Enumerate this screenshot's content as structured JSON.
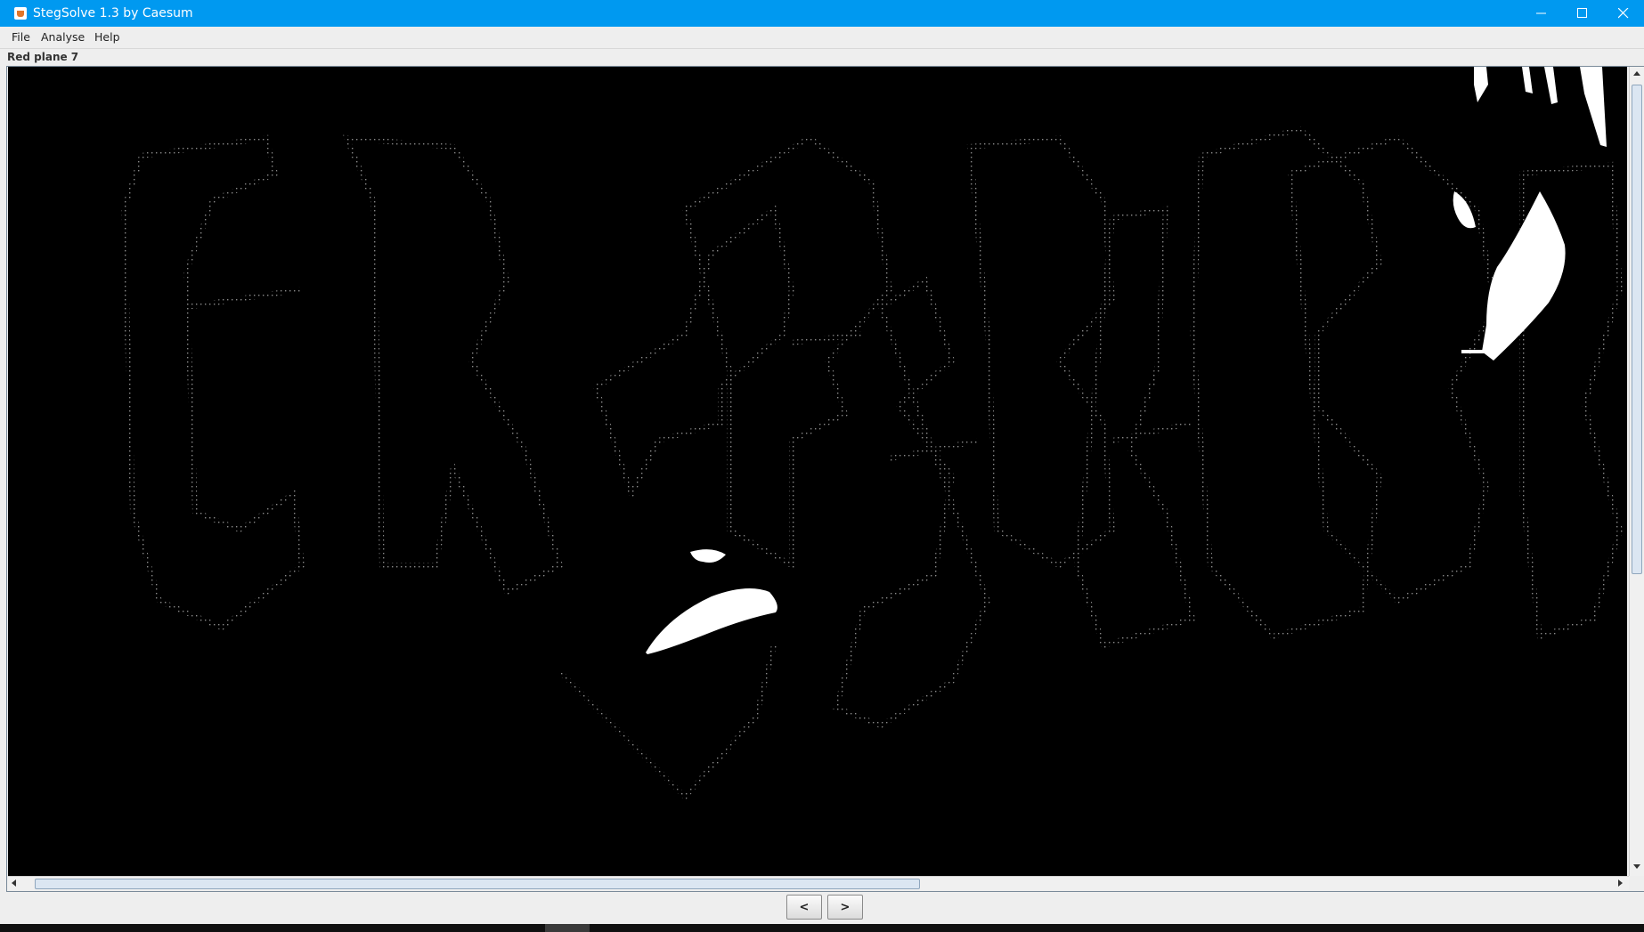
{
  "window": {
    "title": "StegSolve 1.3 by Caesum",
    "controls": [
      "minimize-icon",
      "maximize-icon",
      "close-icon"
    ]
  },
  "menu": {
    "file": "File",
    "analyse": "Analyse",
    "help": "Help"
  },
  "viewer": {
    "plane_label": "Red plane 7"
  },
  "navigation": {
    "prev_label": "<",
    "next_label": ">"
  },
  "colors": {
    "titlebar": "#0099f0",
    "canvas_background": "#000000",
    "plane_pixels": "#ffffff"
  }
}
